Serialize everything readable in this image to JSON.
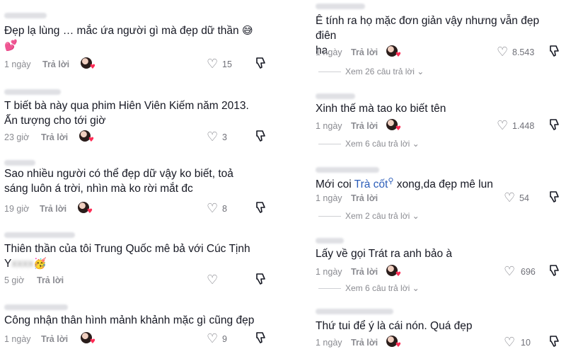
{
  "left": [
    {
      "text_line1": "Đẹp lạ lùng … mắc ứa người gì mà đẹp dữ thần",
      "emoji1": "😅",
      "emoji2": "💕",
      "time": "1 ngày",
      "reply": "Trả lời",
      "likes": "15"
    },
    {
      "text_line1": "T biết bà này qua phim Hiên Viên Kiếm năm 2013.",
      "text_line2": "Ấn tượng cho tới giờ",
      "time": "23 giờ",
      "reply": "Trả lời",
      "likes": "3"
    },
    {
      "text_line1": "Sao nhiều người có thể đẹp dữ vậy ko biết, toả",
      "text_line2": "sáng luôn á trời, nhìn mà ko rời mắt đc",
      "time": "19 giờ",
      "reply": "Trả lời",
      "likes": "8"
    },
    {
      "text_line1": "Thiên thần của tôi Trung Quốc mê bả với Cúc Tịnh",
      "text_line2": "Y",
      "emoji": "🥳",
      "time": "5 giờ",
      "reply": "Trả lời",
      "likes": ""
    },
    {
      "text_line1": "Công nhận thân hình mảnh khảnh mặc gì cũng đẹp",
      "time": "1 ngày",
      "reply": "Trả lời",
      "likes": "9"
    }
  ],
  "right": [
    {
      "text_line1": "Ê tính ra họ mặc đơn giản vậy nhưng vẫn đẹp điên",
      "text_line2": "ha",
      "time": "1 ngày",
      "reply": "Trả lời",
      "likes": "8.543",
      "more": "Xem 26 câu trả lời"
    },
    {
      "text_line1": "Xinh thế mà tao ko biết tên",
      "time": "1 ngày",
      "reply": "Trả lời",
      "likes": "1.448",
      "more": "Xem 6 câu trả lời"
    },
    {
      "text_pre": "Mới coi ",
      "text_link": "Trà cốt",
      "text_post": " xong,da đẹp mê lun",
      "time": "1 ngày",
      "reply": "Trả lời",
      "likes": "54",
      "more": "Xem 2 câu trả lời"
    },
    {
      "text_line1": "Lấy về gọi Trát ra anh bảo à",
      "time": "1 ngày",
      "reply": "Trả lời",
      "likes": "696",
      "more": "Xem 6 câu trả lời"
    },
    {
      "text_line1": "Thứ tui để ý là cái nón. Quá đẹp",
      "time": "1 ngày",
      "reply": "Trả lời",
      "likes": "10"
    }
  ],
  "icons": {
    "like": "heart-outline-icon",
    "dislike": "thumbs-down-icon",
    "search": "search-icon",
    "chevron": "chevron-down-icon"
  },
  "colors": {
    "text": "#161823",
    "meta": "#8a8b91",
    "link": "#2b5db9",
    "heart": "#fe2c55"
  }
}
